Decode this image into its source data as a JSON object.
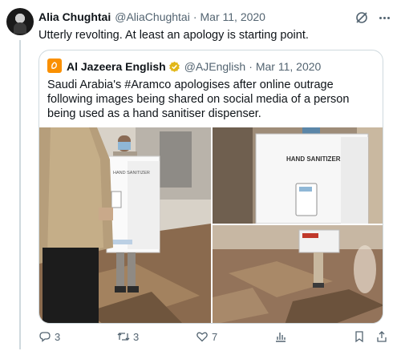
{
  "tweet": {
    "author_name": "Alia Chughtai",
    "author_handle": "@AliaChughtai",
    "separator": "·",
    "date": "Mar 11, 2020",
    "text": "Utterly revolting. At least an apology is starting point.",
    "avatar_icon": "profile-photo"
  },
  "quote": {
    "author_name": "Al Jazeera English",
    "author_handle": "@AJEnglish",
    "separator": "·",
    "date": "Mar 11, 2020",
    "text": "Saudi Arabia's #Aramco apologises after online outrage following images being shared on social media of a person being used as a hand sanitiser dispenser.",
    "logo_color": "#fa9000",
    "verified_color": "#e2b719"
  },
  "media": {
    "sign_text": "HAND SANITIZER"
  },
  "actions": {
    "replies": "3",
    "retweets": "3",
    "likes": "7",
    "reply_icon": "reply-icon",
    "retweet_icon": "retweet-icon",
    "like_icon": "heart-icon",
    "views_icon": "views-icon",
    "bookmark_icon": "bookmark-icon",
    "share_icon": "share-icon"
  },
  "colors": {
    "text": "#0f1419",
    "muted": "#536471",
    "border": "#cfd9de"
  }
}
